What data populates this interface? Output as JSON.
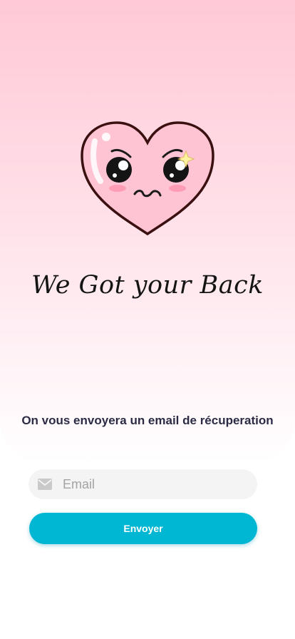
{
  "hero": {
    "illustration": "cute-heart-mascot",
    "headline": "We Got your Back"
  },
  "form": {
    "subtitle": "On vous envoyera un email de récuperation",
    "email": {
      "icon": "mail-icon",
      "placeholder": "Email",
      "value": ""
    },
    "submit_label": "Envoyer"
  },
  "colors": {
    "accent": "#00b7d3",
    "gradient_top": "#ffc9d7",
    "heart_fill": "#ffc4d3",
    "heart_outline": "#3a1010",
    "text_dark": "#2b2b45"
  }
}
